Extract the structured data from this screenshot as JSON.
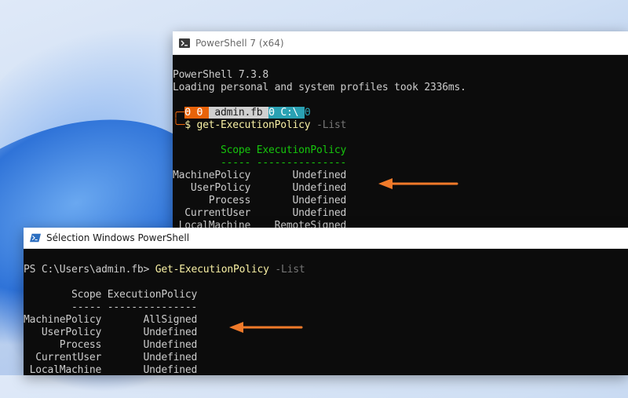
{
  "colors": {
    "terminal_bg": "#0c0c0c",
    "terminal_fg": "#cccccc",
    "header_green": "#16c60c",
    "command_yellow": "#f9f1a5",
    "param_gray": "#767676",
    "prompt_orange": "#e8630a",
    "prompt_cyan": "#2aa1b3",
    "arrow_orange": "#f07a2a"
  },
  "ps7_window": {
    "title": "PowerShell 7 (x64)",
    "icon": "powershell-icon",
    "banner_line1": "PowerShell 7.3.8",
    "banner_line2": "Loading personal and system profiles took 2336ms.",
    "prompt_glyph1": "╭─",
    "prompt_seg1": "Θ Θ ",
    "prompt_user": " admin.fb ",
    "prompt_seg3": "Θ C:\\ ",
    "prompt_end": "Θ",
    "prompt_glyph2": "╰─",
    "prompt_symbol": "$ ",
    "command": "get-ExecutionPolicy",
    "param": " -List",
    "header_row": "        Scope ExecutionPolicy",
    "divider_row": "        ----- ---------------",
    "rows": [
      "MachinePolicy       Undefined",
      "   UserPolicy       Undefined",
      "      Process       Undefined",
      "  CurrentUser       Undefined",
      " LocalMachine    RemoteSigned"
    ]
  },
  "wps_window": {
    "title": "Sélection Windows PowerShell",
    "icon": "powershell-icon",
    "prompt": "PS C:\\Users\\admin.fb> ",
    "command": "Get-ExecutionPolicy",
    "param": " -List",
    "header_row": "        Scope ExecutionPolicy",
    "divider_row": "        ----- ---------------",
    "rows": [
      "MachinePolicy       AllSigned",
      "   UserPolicy       Undefined",
      "      Process       Undefined",
      "  CurrentUser       Undefined",
      " LocalMachine       Undefined"
    ]
  }
}
